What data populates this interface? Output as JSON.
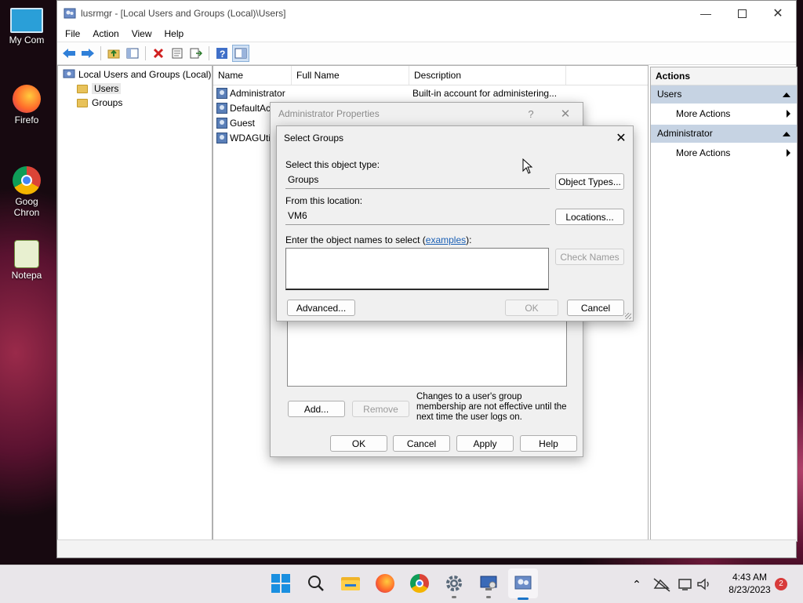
{
  "desktop": {
    "icons": [
      {
        "label": "My Com"
      },
      {
        "label": "Firefo"
      },
      {
        "label": "Goog Chron"
      },
      {
        "label": "Notepa"
      }
    ]
  },
  "window": {
    "title": "lusrmgr - [Local Users and Groups (Local)\\Users]",
    "menu": [
      "File",
      "Action",
      "View",
      "Help"
    ]
  },
  "tree": {
    "root": "Local Users and Groups (Local)",
    "children": [
      "Users",
      "Groups"
    ]
  },
  "list": {
    "columns": [
      "Name",
      "Full Name",
      "Description"
    ],
    "rows": [
      {
        "name": "Administrator",
        "fullname": "",
        "description": "Built-in account for administering..."
      },
      {
        "name": "DefaultAc",
        "fullname": "",
        "description": ""
      },
      {
        "name": "Guest",
        "fullname": "",
        "description": ""
      },
      {
        "name": "WDAGUti",
        "fullname": "",
        "description": ""
      }
    ]
  },
  "actions": {
    "header": "Actions",
    "sections": [
      {
        "title": "Users",
        "item": "More Actions"
      },
      {
        "title": "Administrator",
        "item": "More Actions"
      }
    ]
  },
  "props_dialog": {
    "title": "Administrator Properties",
    "help_glyph": "?",
    "note": "Changes to a user's group membership are not effective until the next time the user logs on.",
    "add": "Add...",
    "remove": "Remove",
    "ok": "OK",
    "cancel": "Cancel",
    "apply": "Apply",
    "help": "Help"
  },
  "select_dialog": {
    "title": "Select Groups",
    "object_type_label": "Select this object type:",
    "object_type_value": "Groups",
    "object_types_button": "Object Types...",
    "location_label": "From this location:",
    "location_value": "VM6",
    "locations_button": "Locations...",
    "names_label_prefix": "Enter the object names to select (",
    "names_label_link": "examples",
    "names_label_suffix": "):",
    "names_value": "",
    "check_names": "Check Names",
    "advanced": "Advanced...",
    "ok": "OK",
    "cancel": "Cancel"
  },
  "taskbar": {
    "time": "4:43 AM",
    "date": "8/23/2023",
    "notification_count": "2"
  }
}
